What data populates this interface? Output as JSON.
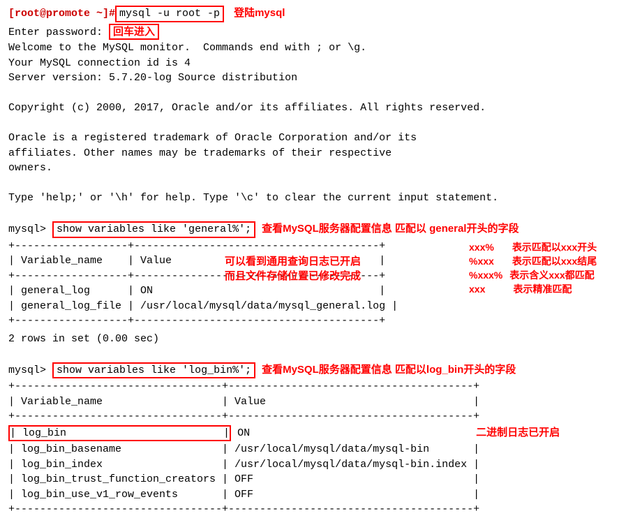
{
  "terminal": {
    "prompt1": "[root@promote ~]#",
    "cmd1": "mysql -u root -p",
    "anno_login": "登陆mysql",
    "line_enter_password": "Enter password:",
    "anno_enter": "回车进入",
    "welcome1": "Welcome to the MySQL monitor.  Commands end with ; or \\g.",
    "welcome2": "Your MySQL connection id is 4",
    "welcome3": "Server version: 5.7.20-log Source distribution",
    "copyright": "Copyright (c) 2000, 2017, Oracle and/or its affiliates. All rights reserved.",
    "oracle1": "Oracle is a registered trademark of Oracle Corporation and/or its",
    "oracle2": "affiliates. Other names may be trademarks of their respective",
    "oracle3": "owners.",
    "help": "Type 'help;' or '\\h' for help. Type '\\c' to clear the current input statement."
  },
  "query1": {
    "prompt": "mysql>",
    "sql": "show variables like 'general%';",
    "anno": "查看MySQL服务器配置信息 匹配以 general开头的字段",
    "anno_detail1": "可以看到通用查询日志已开启",
    "anno_detail2": "而且文件存储位置已修改完成",
    "sep": "+------------------+---------------------------------------+",
    "header": "| Variable_name    | Value                                 |",
    "row1": "| general_log      | ON                                    |",
    "row2": "| general_log_file | /usr/local/mysql/data/mysql_general.log |",
    "footer": "2 rows in set (0.00 sec)"
  },
  "pattern_notes": {
    "n1a": "xxx%",
    "n1b": "表示匹配以xxx开头",
    "n2a": "%xxx",
    "n2b": "表示匹配以xxx结尾",
    "n3a": "%xxx%",
    "n3b": "表示含义xxx都匹配",
    "n4a": "xxx",
    "n4b": "表示精准匹配"
  },
  "query2": {
    "prompt": "mysql>",
    "sql": "show variables like 'log_bin%';",
    "anno": "查看MySQL服务器配置信息 匹配以log_bin开头的字段",
    "anno_detail": "二进制日志已开启",
    "sep": "+---------------------------------+---------------------------------------+",
    "header": "| Variable_name                   | Value                                 |",
    "row1a": "| log_bin                         |",
    "row1b": " ON                                    ",
    "row2": "| log_bin_basename                | /usr/local/mysql/data/mysql-bin       |",
    "row3": "| log_bin_index                   | /usr/local/mysql/data/mysql-bin.index |",
    "row4": "| log_bin_trust_function_creators | OFF                                   |",
    "row5": "| log_bin_use_v1_row_events       | OFF                                   |"
  }
}
